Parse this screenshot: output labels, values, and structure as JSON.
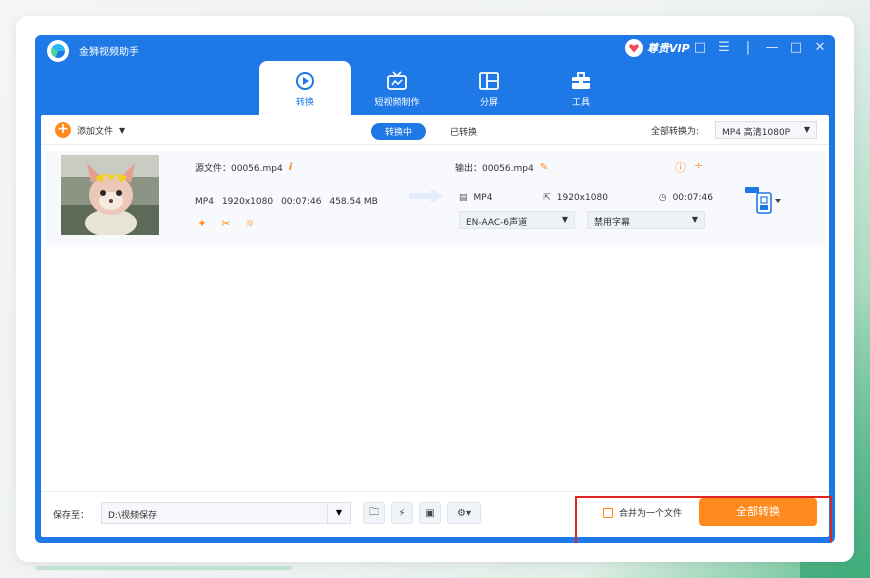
{
  "app": {
    "title": "金狮视频助手",
    "vip_label": "尊贵VIP"
  },
  "tabs": [
    {
      "label": "转换",
      "icon": "convert-icon",
      "active": true
    },
    {
      "label": "短视频制作",
      "icon": "tv-icon",
      "active": false
    },
    {
      "label": "分屏",
      "icon": "split-screen-icon",
      "active": false
    },
    {
      "label": "工具",
      "icon": "toolbox-icon",
      "active": false
    }
  ],
  "toolbar": {
    "add_file": "添加文件",
    "seg_converting": "转换中",
    "seg_converted": "已转换",
    "convert_all_to": "全部转换为:",
    "format_value": "MP4 高清1080P"
  },
  "file": {
    "source_name": "源文件：00056.mp4",
    "source_format": "MP4",
    "source_resolution": "1920x1080",
    "source_duration": "00:07:46",
    "source_size": "458.54 MB",
    "output_name": "输出：00056.mp4",
    "output_format": "MP4",
    "output_resolution": "1920x1080",
    "output_duration": "00:07:46",
    "audio_track": "EN-AAC-6声道",
    "subtitle": "禁用字幕"
  },
  "bottom": {
    "save_to": "保存至：",
    "save_path": "D:\\视频保存",
    "merge_label": "合并为一个文件",
    "convert_all_button": "全部转换"
  },
  "colors": {
    "brand_blue": "#1e78e6",
    "accent_orange": "#ff8a1e",
    "highlight_red": "#e02424"
  }
}
